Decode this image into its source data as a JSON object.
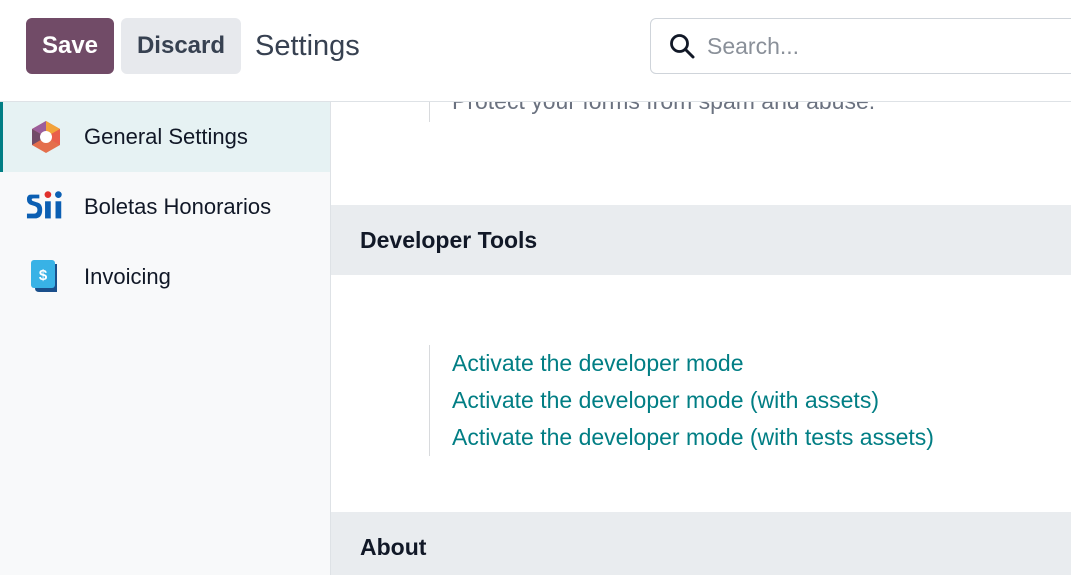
{
  "toolbar": {
    "save_label": "Save",
    "discard_label": "Discard",
    "title": "Settings"
  },
  "search": {
    "placeholder": "Search...",
    "value": ""
  },
  "sidebar": {
    "items": [
      {
        "label": "General Settings",
        "icon": "general-settings-icon",
        "active": true
      },
      {
        "label": "Boletas Honorarios",
        "icon": "sii-icon",
        "active": false
      },
      {
        "label": "Invoicing",
        "icon": "invoicing-icon",
        "active": false
      }
    ]
  },
  "main": {
    "partial_text": "Protect your forms from spam and abuse.",
    "developer_tools": {
      "title": "Developer Tools",
      "links": [
        "Activate the developer mode",
        "Activate the developer mode (with assets)",
        "Activate the developer mode (with tests assets)"
      ]
    },
    "about": {
      "title": "About"
    }
  },
  "colors": {
    "brand": "#714b67",
    "link": "#017e84",
    "section_bg": "#e9ecef",
    "sidebar_active": "#e6f2f3"
  }
}
